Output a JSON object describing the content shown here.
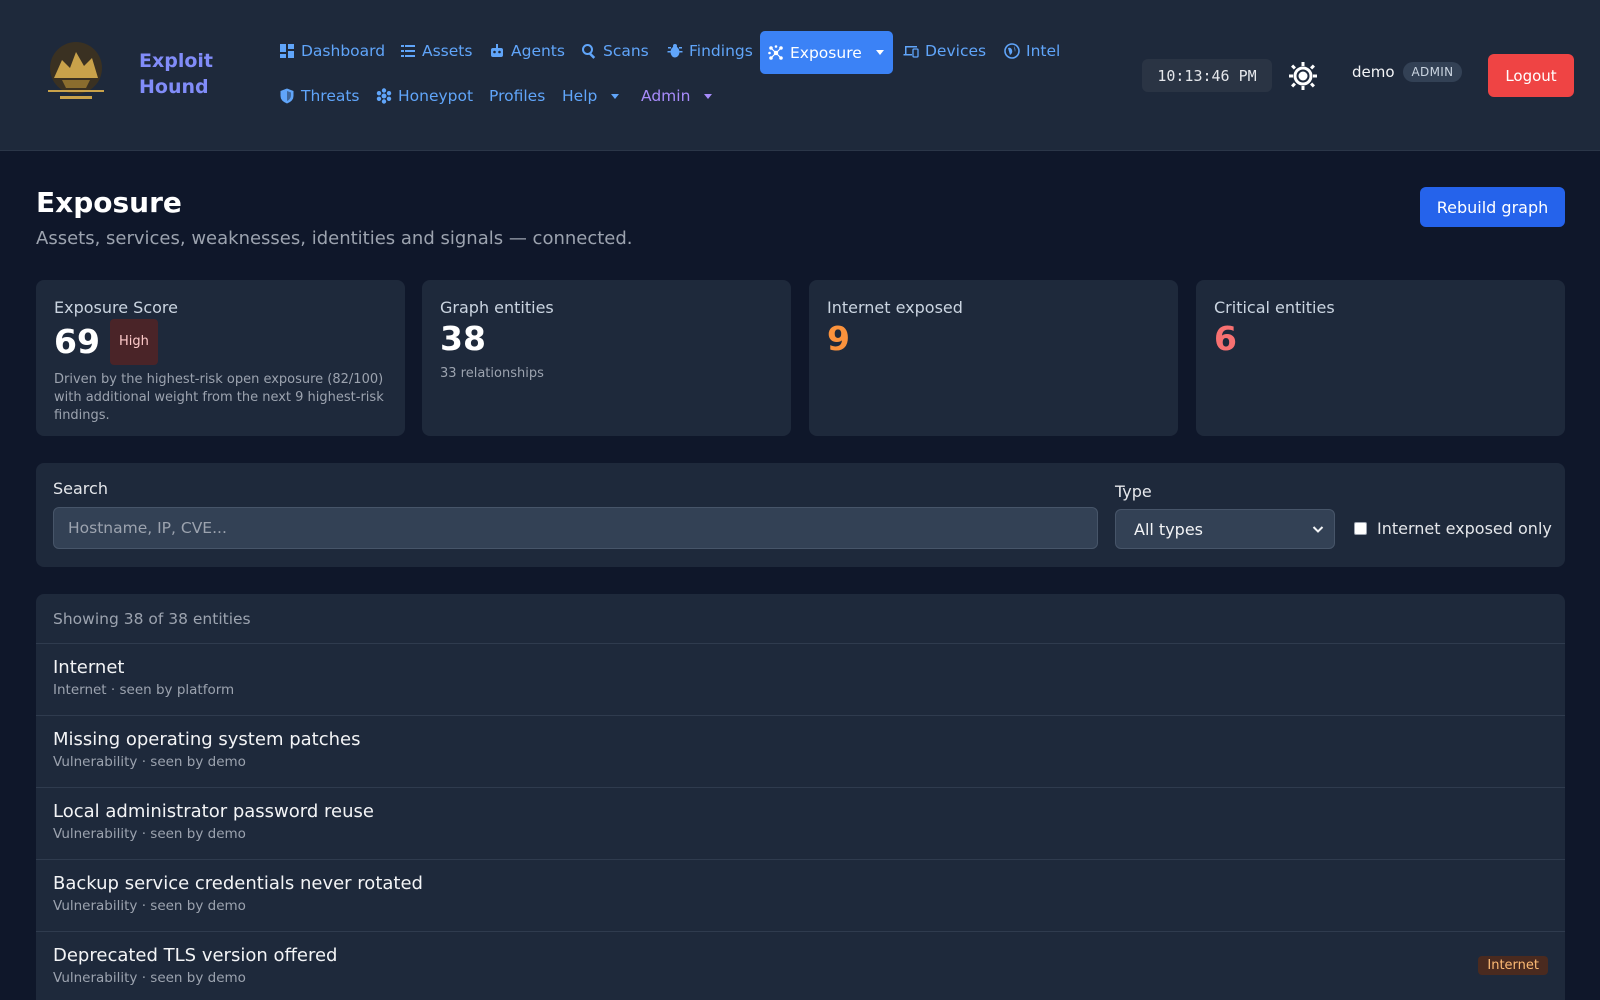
{
  "brand": {
    "line1": "Exploit",
    "line2": "Hound"
  },
  "nav": {
    "dashboard": "Dashboard",
    "assets": "Assets",
    "agents": "Agents",
    "scans": "Scans",
    "findings": "Findings",
    "exposure": "Exposure",
    "devices": "Devices",
    "intel": "Intel",
    "threats": "Threats",
    "honeypot": "Honeypot",
    "profiles": "Profiles",
    "help": "Help",
    "admin": "Admin"
  },
  "header": {
    "clock": "10:13:46 PM",
    "username": "demo",
    "role": "ADMIN",
    "logout_label": "Logout"
  },
  "page": {
    "title": "Exposure",
    "subtitle": "Assets, services, weaknesses, identities and signals — connected.",
    "rebuild_label": "Rebuild graph"
  },
  "stats": {
    "score": {
      "label": "Exposure Score",
      "value": "69",
      "badge": "High",
      "description": "Driven by the highest-risk open exposure (82/100) with additional weight from the next 9 highest-risk findings."
    },
    "entities": {
      "label": "Graph entities",
      "value": "38",
      "sub": "33 relationships"
    },
    "internet": {
      "label": "Internet exposed",
      "value": "9"
    },
    "critical": {
      "label": "Critical entities",
      "value": "6"
    }
  },
  "filters": {
    "search_label": "Search",
    "search_placeholder": "Hostname, IP, CVE...",
    "search_value": "",
    "type_label": "Type",
    "type_selected": "All types",
    "internet_only_label": "Internet exposed only",
    "internet_only_checked": false
  },
  "list": {
    "summary": "Showing 38 of 38 entities",
    "items": [
      {
        "title": "Internet",
        "meta": "Internet · seen by platform",
        "badge": ""
      },
      {
        "title": "Missing operating system patches",
        "meta": "Vulnerability · seen by demo",
        "badge": ""
      },
      {
        "title": "Local administrator password reuse",
        "meta": "Vulnerability · seen by demo",
        "badge": ""
      },
      {
        "title": "Backup service credentials never rotated",
        "meta": "Vulnerability · seen by demo",
        "badge": ""
      },
      {
        "title": "Deprecated TLS version offered",
        "meta": "Vulnerability · seen by demo",
        "badge": "Internet"
      }
    ]
  },
  "colors": {
    "accent": "#3b82f6",
    "brand": "#818cf8",
    "danger": "#ef4444",
    "orange": "#fb923c",
    "critical": "#f87171"
  },
  "icons": {
    "dashboard": "dashboard-icon",
    "assets": "list-icon",
    "agents": "robot-icon",
    "scans": "search-icon",
    "findings": "bug-icon",
    "exposure": "graph-icon",
    "devices": "devices-icon",
    "intel": "globe-icon",
    "threats": "shield-icon",
    "honeypot": "honeycomb-icon",
    "theme": "sun-icon"
  }
}
